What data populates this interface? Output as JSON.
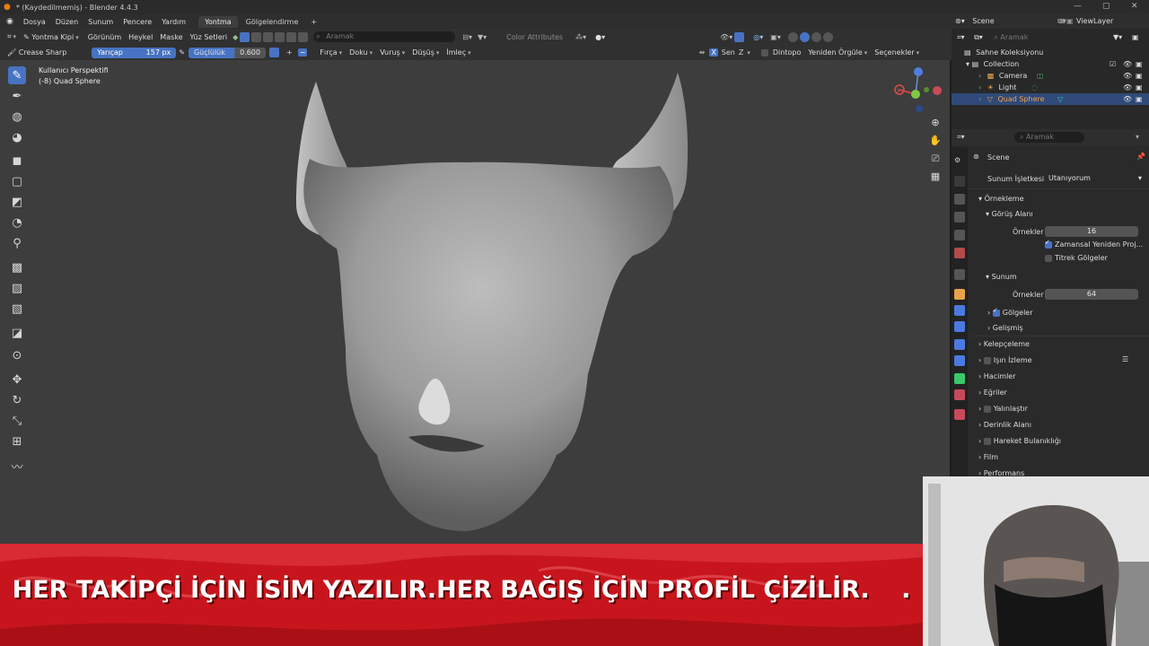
{
  "window": {
    "title": "* (Kaydedilmemiş) - Blender 4.4.3"
  },
  "menu": {
    "items": [
      "Dosya",
      "Düzen",
      "Sunum",
      "Pencere",
      "Yardım"
    ],
    "workspaces": [
      "Yontma",
      "Gölgelendirme"
    ],
    "add_tab": "+"
  },
  "header": {
    "mode": "Yontma Kipi",
    "items": [
      "Görünüm",
      "Heykel",
      "Maske",
      "Yüz Setleri"
    ],
    "search_placeholder": "Aramak",
    "color_attr": "Color Attributes"
  },
  "tool": {
    "brush": "Crease Sharp",
    "radius_label": "Yarıçap",
    "radius_value": "157 px",
    "strength_label": "Güçlülük",
    "strength_value": "0.600",
    "menus": [
      "Fırça",
      "Doku",
      "Vuruş",
      "Düşüş",
      "İmleç"
    ],
    "sym_label": "Sen",
    "axis_x": "X",
    "axis_y": "Z",
    "dyntopo": "Dintopo",
    "remesh": "Yeniden Örgüle",
    "options": "Seçenekler"
  },
  "viewport": {
    "perspective": "Kullanıcı Perspektifi",
    "object": "(-8) Quad Sphere"
  },
  "outliner": {
    "scene": "Scene",
    "view_layer": "ViewLayer",
    "search_placeholder": "Aramak",
    "root": "Sahne Koleksiyonu",
    "collection": "Collection",
    "objects": [
      "Camera",
      "Light",
      "Quad Sphere"
    ]
  },
  "properties": {
    "search_placeholder": "Aramak",
    "scene": "Scene",
    "engine_label": "Sunum İşletkesi",
    "engine_value": "Utanıyorum",
    "sampling": "Örnekleme",
    "viewport_section": "Görüş Alanı",
    "samples_label": "Örnekler",
    "viewport_samples": "16",
    "temporal": "Zamansal Yeniden Proj...",
    "jitter": "Titrek Gölgeler",
    "render_section": "Sunum",
    "render_samples": "64",
    "shadows": "Gölgeler",
    "advanced": "Gelişmiş",
    "panels": [
      "Kelepçeleme",
      "Işın İzleme",
      "Hacimler",
      "Eğriler",
      "Yalınlaştır",
      "Derinlik Alanı",
      "Hareket Bulanıklığı",
      "Film",
      "Performans"
    ]
  },
  "banner": {
    "text": "HER TAKİPÇİ İÇİN İSİM YAZILIR.HER BAĞIŞ İÇİN PROFİL ÇİZİLİR.",
    "dot": "."
  },
  "colors": {
    "accent": "#4773c2",
    "banner_red": "#c8151d",
    "viewport_bg": "#3d3d3d"
  }
}
